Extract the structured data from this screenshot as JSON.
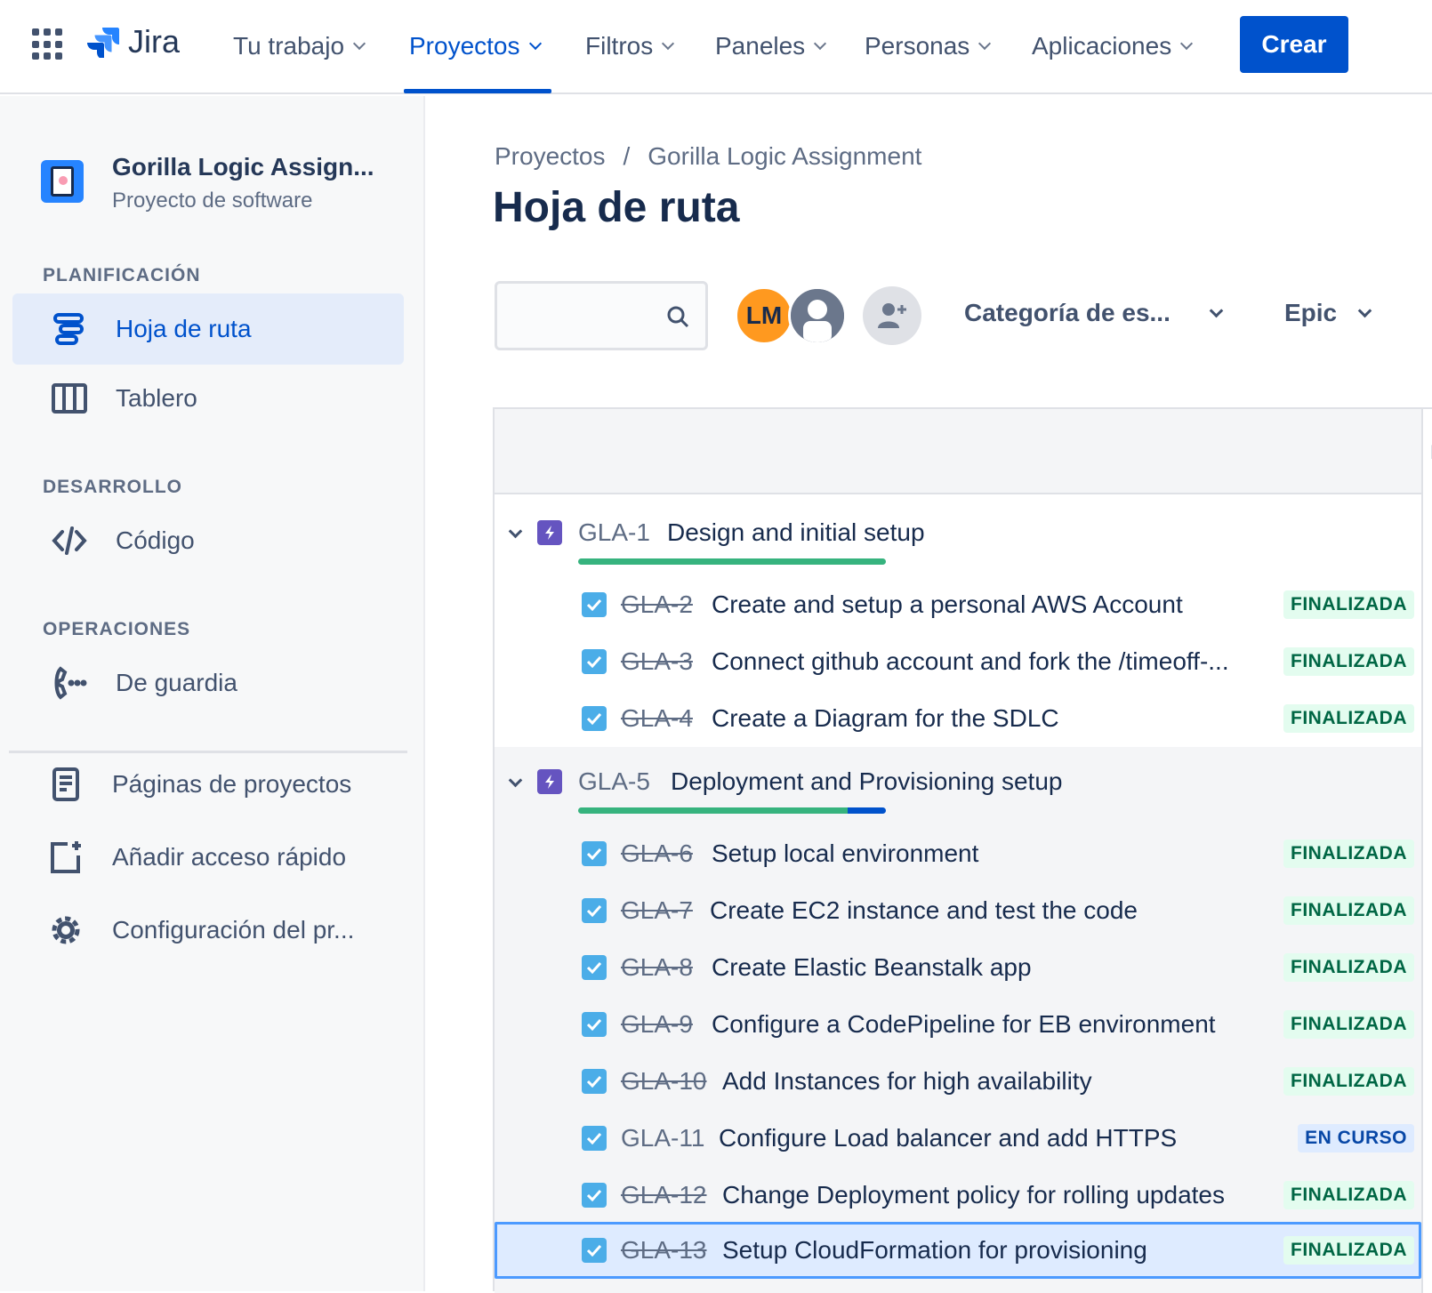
{
  "topnav": {
    "logo_text": "Jira",
    "items": [
      {
        "label": "Tu trabajo"
      },
      {
        "label": "Proyectos"
      },
      {
        "label": "Filtros"
      },
      {
        "label": "Paneles"
      },
      {
        "label": "Personas"
      },
      {
        "label": "Aplicaciones"
      }
    ],
    "active_item": "Proyectos",
    "create_label": "Crear"
  },
  "sidebar": {
    "project_name": "Gorilla Logic Assign...",
    "project_type": "Proyecto de software",
    "sections": [
      {
        "heading": "PLANIFICACIÓN",
        "items": [
          {
            "label": "Hoja de ruta",
            "icon": "roadmap-icon",
            "active": true
          },
          {
            "label": "Tablero",
            "icon": "board-icon",
            "active": false
          }
        ]
      },
      {
        "heading": "DESARROLLO",
        "items": [
          {
            "label": "Código",
            "icon": "code-icon",
            "active": false
          }
        ]
      },
      {
        "heading": "OPERACIONES",
        "items": [
          {
            "label": "De guardia",
            "icon": "on-call-icon",
            "active": false
          }
        ]
      }
    ],
    "footer_items": [
      {
        "label": "Páginas de proyectos",
        "icon": "page-icon"
      },
      {
        "label": "Añadir acceso rápido",
        "icon": "add-shortcut-icon"
      },
      {
        "label": "Configuración del pr...",
        "icon": "gear-icon"
      }
    ]
  },
  "main": {
    "breadcrumb": {
      "root": "Proyectos",
      "separator": "/",
      "current": "Gorilla Logic Assignment"
    },
    "title": "Hoja de ruta",
    "search": {
      "placeholder": "",
      "value": ""
    },
    "avatars": [
      {
        "initials": "LM",
        "color": "#ff991f"
      },
      {
        "initials": "",
        "icon": "user-icon"
      }
    ],
    "filters": [
      {
        "label": "Categoría de es..."
      },
      {
        "label": "Epic"
      }
    ],
    "header_cut_text": "E"
  },
  "roadmap": {
    "epics": [
      {
        "key": "GLA-1",
        "title": "Design and initial setup",
        "progress": {
          "done": 1.0,
          "in_progress": 0.0
        },
        "tasks": [
          {
            "key": "GLA-2",
            "title": "Create and setup a personal AWS Account",
            "status": "FINALIZADA",
            "done": true
          },
          {
            "key": "GLA-3",
            "title": "Connect github account and fork the /timeoff-...",
            "status": "FINALIZADA",
            "done": true
          },
          {
            "key": "GLA-4",
            "title": "Create a Diagram for the SDLC",
            "status": "FINALIZADA",
            "done": true
          }
        ]
      },
      {
        "key": "GLA-5",
        "title": "Deployment and Provisioning setup",
        "progress": {
          "done": 0.875,
          "in_progress": 0.125
        },
        "tasks": [
          {
            "key": "GLA-6",
            "title": "Setup local environment",
            "status": "FINALIZADA",
            "done": true
          },
          {
            "key": "GLA-7",
            "title": "Create EC2 instance and test the code",
            "status": "FINALIZADA",
            "done": true
          },
          {
            "key": "GLA-8",
            "title": "Create Elastic Beanstalk app",
            "status": "FINALIZADA",
            "done": true
          },
          {
            "key": "GLA-9",
            "title": "Configure a CodePipeline for EB environment",
            "status": "FINALIZADA",
            "done": true
          },
          {
            "key": "GLA-10",
            "title": "Add Instances for high availability",
            "status": "FINALIZADA",
            "done": true
          },
          {
            "key": "GLA-11",
            "title": "Configure Load balancer and add HTTPS",
            "status": "EN CURSO",
            "done": false
          },
          {
            "key": "GLA-12",
            "title": "Change Deployment policy for rolling updates",
            "status": "FINALIZADA",
            "done": true
          },
          {
            "key": "GLA-13",
            "title": "Setup CloudFormation for provisioning",
            "status": "FINALIZADA",
            "done": true,
            "selected": true
          }
        ]
      }
    ]
  },
  "colors": {
    "primary": "#0052cc",
    "epic": "#6554c0",
    "done": "#36b37e",
    "finalizada_bg": "#e3fcef",
    "en_curso_bg": "#deebff"
  }
}
